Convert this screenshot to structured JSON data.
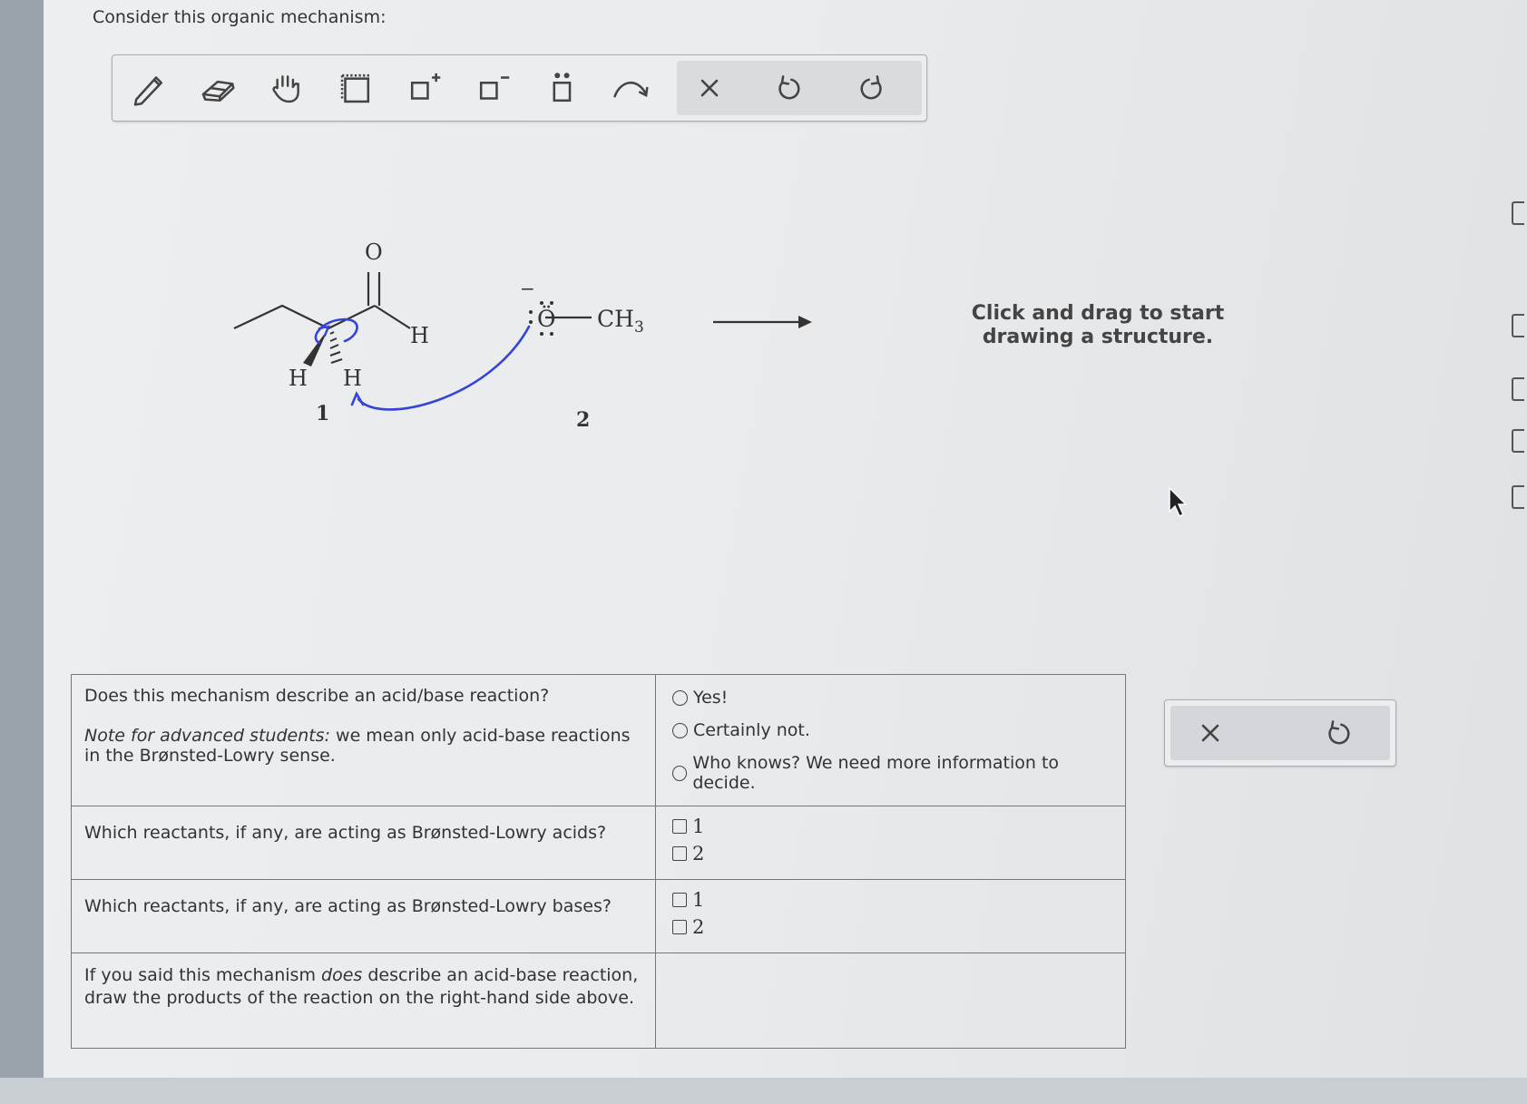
{
  "prompt": "Consider this organic mechanism:",
  "toolbar": {
    "tools": [
      "pencil-icon",
      "eraser-icon",
      "hand-icon",
      "select-box-icon",
      "add-positive-charge-icon",
      "add-negative-charge-icon",
      "lone-pair-icon",
      "curved-arrow-icon",
      "clear-icon",
      "undo-icon",
      "redo-icon"
    ]
  },
  "mechanism": {
    "atom_O": "O",
    "atom_H_aldehyde": "H",
    "atom_H_wedge": "H",
    "atom_H_hash": "H",
    "label_1": "1",
    "label_2": "2",
    "methoxide_O": "Ö",
    "methoxide_group": "CH",
    "methoxide_sub": "3",
    "charge": "−",
    "arrow_color": "#3344d6"
  },
  "hint": {
    "line1": "Click and drag to start",
    "line2": "drawing a structure."
  },
  "questions": {
    "q1": {
      "text": "Does this mechanism describe an acid/base reaction?",
      "note_em": "Note for advanced students:",
      "note_rest": " we mean only acid-base reactions in the Brønsted-Lowry sense.",
      "options": [
        "Yes!",
        "Certainly not.",
        "Who knows? We need more information to decide."
      ]
    },
    "q2": {
      "text": "Which reactants, if any, are acting as Brønsted-Lowry acids?",
      "options": [
        "1",
        "2"
      ]
    },
    "q3": {
      "text": "Which reactants, if any, are acting as Brønsted-Lowry bases?",
      "options": [
        "1",
        "2"
      ]
    },
    "q4": {
      "pre": "If you said this mechanism ",
      "em": "does",
      "post": " describe an acid-base reaction, draw the products of the reaction on the right-hand side above."
    }
  },
  "side_tools": [
    "clear-icon",
    "undo-icon"
  ]
}
